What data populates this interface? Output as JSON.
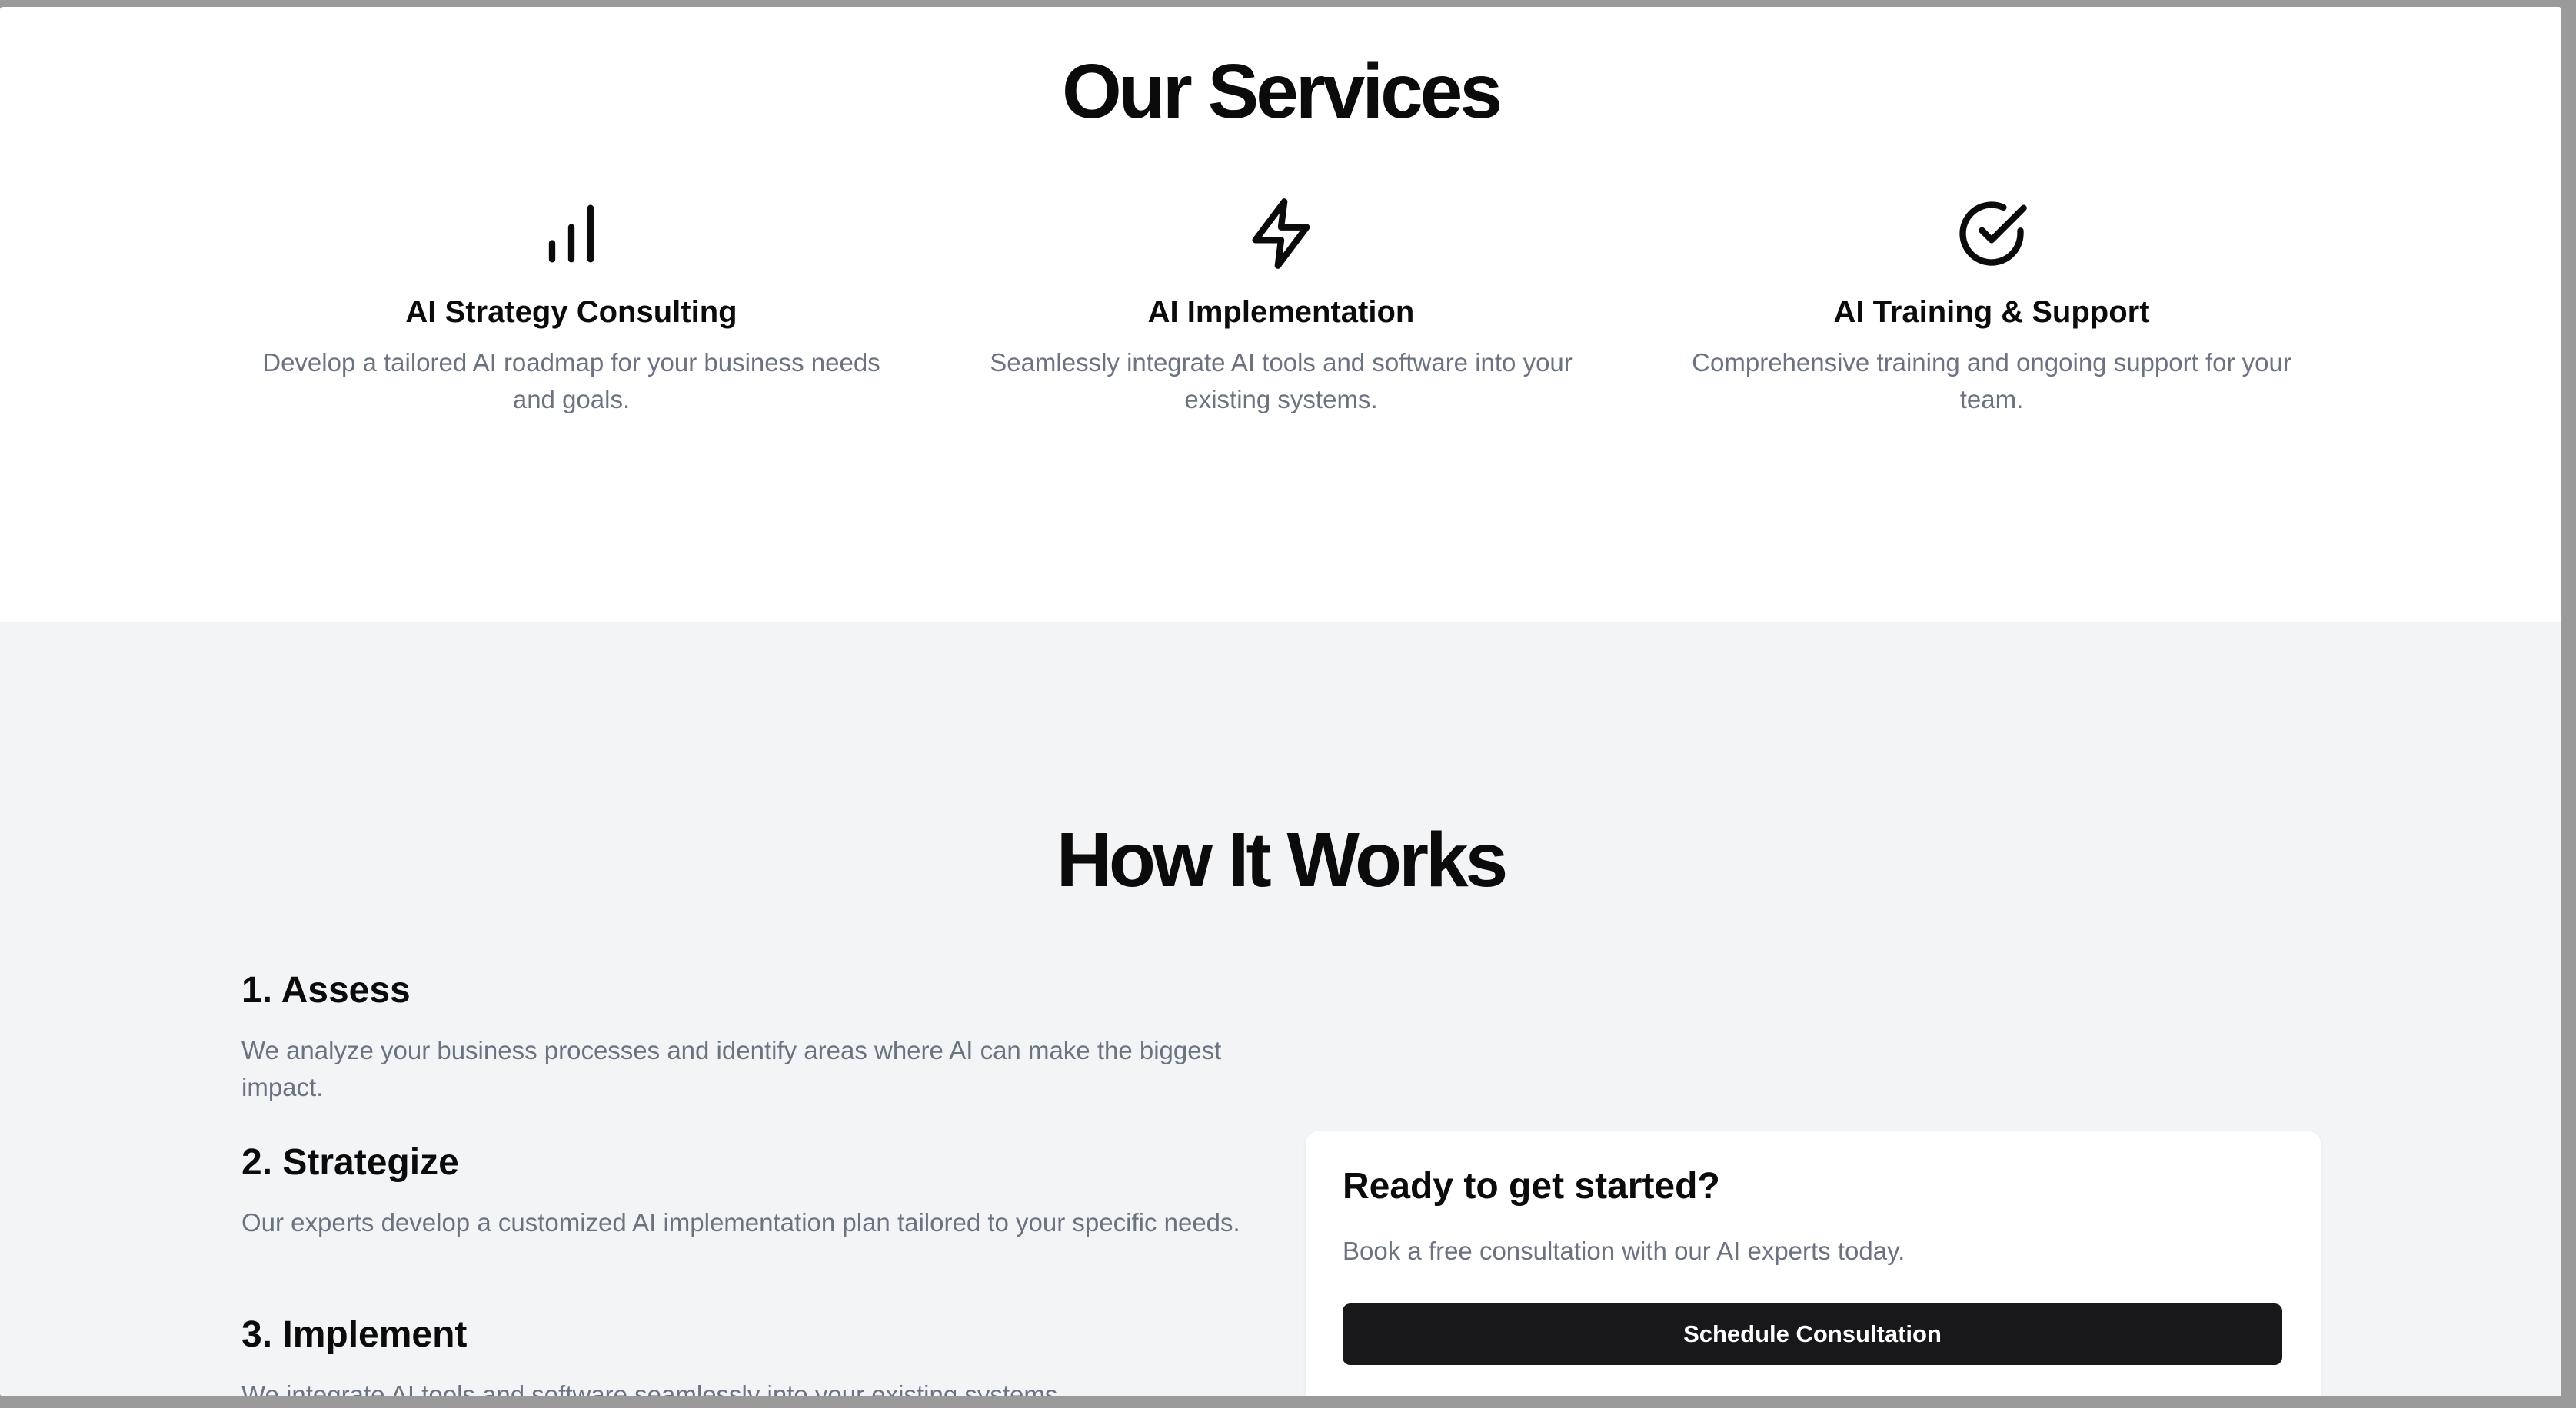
{
  "services": {
    "title": "Our Services",
    "cards": [
      {
        "icon": "bar-chart-icon",
        "title": "AI Strategy Consulting",
        "description": "Develop a tailored AI roadmap for your business needs and goals."
      },
      {
        "icon": "lightning-bolt-icon",
        "title": "AI Implementation",
        "description": "Seamlessly integrate AI tools and software into your existing systems."
      },
      {
        "icon": "check-circle-icon",
        "title": "AI Training & Support",
        "description": "Comprehensive training and ongoing support for your team."
      }
    ]
  },
  "how_it_works": {
    "title": "How It Works",
    "steps": [
      {
        "title": "1. Assess",
        "description": "We analyze your business processes and identify areas where AI can make the biggest impact."
      },
      {
        "title": "2. Strategize",
        "description": "Our experts develop a customized AI implementation plan tailored to your specific needs."
      },
      {
        "title": "3. Implement",
        "description": "We integrate AI tools and software seamlessly into your existing systems."
      }
    ]
  },
  "cta": {
    "title": "Ready to get started?",
    "description": "Book a free consultation with our AI experts today.",
    "button_label": "Schedule Consultation"
  },
  "colors": {
    "heading": "#0b0b0c",
    "body_text": "#6b7280",
    "section_alt_bg": "#f3f4f6",
    "button_bg": "#18181b"
  }
}
